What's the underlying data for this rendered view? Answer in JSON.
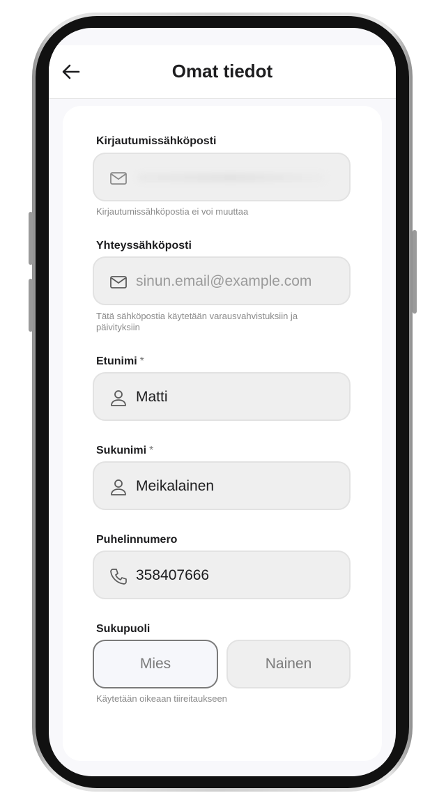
{
  "header": {
    "title": "Omat tiedot"
  },
  "form": {
    "login_email": {
      "label": "Kirjautumissähköposti",
      "value": "",
      "help": "Kirjautumissähköpostia ei voi muuttaa"
    },
    "contact_email": {
      "label": "Yhteyssähköposti",
      "placeholder": "sinun.email@example.com",
      "help": "Tätä sähköpostia käytetään varausvahvistuksiin ja päivityksiin"
    },
    "first_name": {
      "label": "Etunimi",
      "required_mark": "*",
      "value": "Matti"
    },
    "last_name": {
      "label": "Sukunimi",
      "required_mark": "*",
      "value": "Meikalainen"
    },
    "phone": {
      "label": "Puhelinnumero",
      "value": "358407666"
    },
    "gender": {
      "label": "Sukupuoli",
      "options": [
        "Mies",
        "Nainen"
      ],
      "selected": "Mies",
      "help": "Käytetään oikeaan tiireitaukseen"
    }
  },
  "icons": {
    "back": "arrow-left-icon",
    "email": "mail-icon",
    "person": "person-icon",
    "phone": "phone-icon"
  },
  "colors": {
    "field_bg": "#efefef",
    "selected_border": "#7a7a7a",
    "text_primary": "#1d1d1f",
    "text_muted": "#8a8a8a"
  }
}
